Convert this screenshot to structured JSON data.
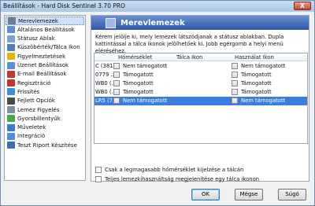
{
  "window": {
    "title": "Beállítások  -  Hard Disk Sentinel 3.70 PRO",
    "close_label": "X"
  },
  "sidebar": {
    "items": [
      {
        "label": "Merevlemezek",
        "icon": "hdd-icon",
        "color": "#6b7c93",
        "selected": true
      },
      {
        "label": "Általános Beállítások",
        "icon": "settings-icon",
        "color": "#5a8fd6"
      },
      {
        "label": "Státusz Ablak",
        "icon": "window-icon",
        "color": "#7aa2d4"
      },
      {
        "label": "Küszöbérték/Tálca Ikon",
        "icon": "taskbar-icon",
        "color": "#4f7fbf"
      },
      {
        "label": "Figyelmeztetések",
        "icon": "warning-icon",
        "color": "#e3b400"
      },
      {
        "label": "Üzenet Beállítások",
        "icon": "message-icon",
        "color": "#5a8fd6"
      },
      {
        "label": "E-mail Beállítások",
        "icon": "email-icon",
        "color": "#c33a2c"
      },
      {
        "label": "Regisztráció",
        "icon": "registration-icon",
        "color": "#c7322b"
      },
      {
        "label": "Frissítés",
        "icon": "update-icon",
        "color": "#3d8ee0"
      },
      {
        "label": "Fejlett Opciók",
        "icon": "advanced-icon",
        "color": "#4a4a4a"
      },
      {
        "label": "Lemez Figyelés",
        "icon": "disk-monitor-icon",
        "color": "#7d8ea5"
      },
      {
        "label": "Gyorsbillentyűk",
        "icon": "hotkey-icon",
        "color": "#4aa84a"
      },
      {
        "label": "Műveletek",
        "icon": "actions-icon",
        "color": "#3c78d8"
      },
      {
        "label": "Integráció",
        "icon": "integration-icon",
        "color": "#4a90e2"
      },
      {
        "label": "Teszt Riport Készítése",
        "icon": "report-icon",
        "color": "#3a6fb0"
      }
    ]
  },
  "panel": {
    "title": "Merevlemezek",
    "description": "Kérem jelölje ki, mely lemezek látszódjanak a státusz ablakban. Dupla kattintással a tálca ikonok jelölhetőek ki. Jobb egérgomb a helyi menü eléréséhez.",
    "columns": [
      "Hőmérséklet",
      "Tálca Ikon",
      "Használat Ikon"
    ],
    "rows": [
      {
        "disk": "C (381...",
        "temp": "Nem támogatott",
        "usage": "Nem támogatott",
        "selected": false
      },
      {
        "disk": "0779 ...",
        "temp": "Támogatott",
        "usage": "Támogatott",
        "selected": false
      },
      {
        "disk": "WB0 (...",
        "temp": "Támogatott",
        "usage": "Támogatott",
        "selected": false
      },
      {
        "disk": "WB0 (...",
        "temp": "Támogatott",
        "usage": "Támogatott",
        "selected": false
      },
      {
        "disk": "LR5 (7...",
        "temp": "Nem támogatott",
        "usage": "Nem támogatott",
        "selected": true
      }
    ],
    "option1": "Csak a legmagasabb hőmérséklet kijelzése a tálcán",
    "option2": "Teljes lemezkihasználtság megjelenítése egy tálca ikonon"
  },
  "buttons": {
    "ok": "OK",
    "cancel": "Mégse",
    "help": "Súgó"
  }
}
